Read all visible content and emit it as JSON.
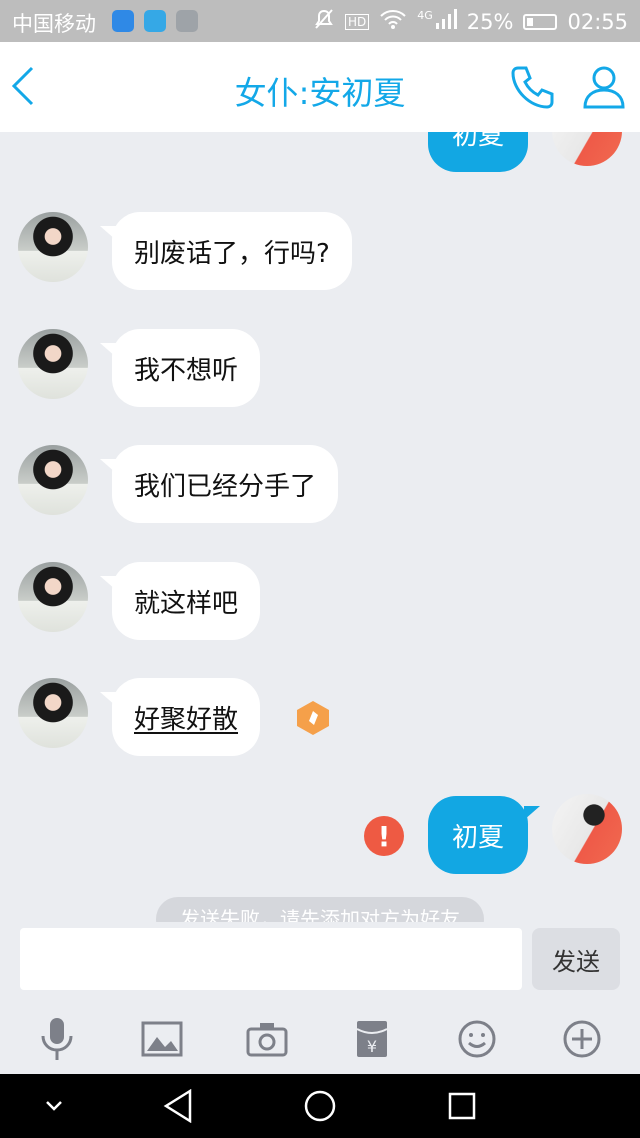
{
  "status_bar": {
    "carrier": "中国移动",
    "battery": "25%",
    "time": "02:55",
    "network": "4G",
    "hd": "HD"
  },
  "header": {
    "title": "女仆:安初夏"
  },
  "messages": [
    {
      "side": "out",
      "text": "初夏"
    },
    {
      "side": "in",
      "text": "别废话了，行吗?"
    },
    {
      "side": "in",
      "text": "我不想听"
    },
    {
      "side": "in",
      "text": "我们已经分手了"
    },
    {
      "side": "in",
      "text": "就这样吧"
    },
    {
      "side": "in",
      "text": "好聚好散"
    },
    {
      "side": "out",
      "text": "初夏",
      "status": "failed"
    }
  ],
  "system_notice": "发送失败，请先添加对方为好友",
  "composer": {
    "placeholder": "",
    "send_label": "发送"
  },
  "toolbar_icons": [
    "microphone-icon",
    "image-icon",
    "camera-icon",
    "red-packet-icon",
    "emoji-icon",
    "plus-icon"
  ],
  "colors": {
    "accent": "#13a8e8",
    "outgoing_bubble": "#12a7e3",
    "error": "#ee5a43"
  }
}
